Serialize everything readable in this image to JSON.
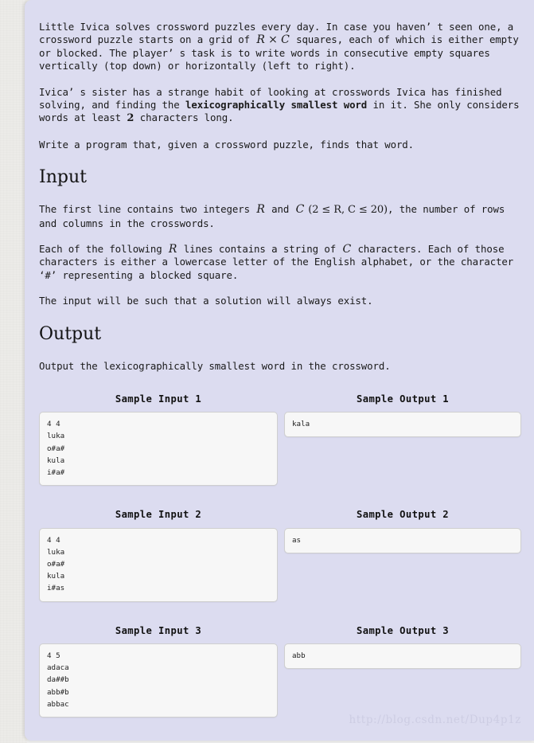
{
  "problem": {
    "paragraphs": [
      {
        "id": "p1",
        "text_parts": [
          "Little Ivica solves crossword puzzles every day. In case you haven’ t seen one, a crossword puzzle starts on a grid of ",
          "R × C",
          " squares, each of which is either empty or blocked. The player’ s task is to write words in consecutive empty squares vertically (top down) or horizontally (left to right)."
        ]
      },
      {
        "id": "p2",
        "text_parts": [
          "Ivica’ s sister has a strange habit of looking at crosswords Ivica has finished solving, and finding the ",
          "lexicographically smallest word",
          " in it. She only considers words at least ",
          "2",
          " characters long."
        ]
      },
      {
        "id": "p3",
        "text": "Write a program that, given a crossword puzzle, finds that word."
      }
    ],
    "input_heading": "Input",
    "input_paragraphs": [
      {
        "id": "in1",
        "text_parts": [
          "The first line contains two integers ",
          "R",
          " and ",
          "C",
          " (2 ≤ R, C ≤ 20)",
          ", the number of rows and columns in the crosswords."
        ]
      },
      {
        "id": "in2",
        "text_parts": [
          "Each of the following ",
          "R",
          " lines contains a string of ",
          "C",
          " characters. Each of those characters is either a lowercase letter of the English alphabet, or the character ‘#’  representing a blocked square."
        ]
      },
      {
        "id": "in3",
        "text": "The input will be such that a solution will always exist."
      }
    ],
    "output_heading": "Output",
    "output_paragraphs": [
      {
        "id": "out1",
        "text": "Output the lexicographically smallest word in the crossword."
      }
    ]
  },
  "samples": [
    {
      "input_title": "Sample Input 1",
      "output_title": "Sample Output 1",
      "input": "4 4\nluka\no#a#\nkula\ni#a#",
      "output": "kala"
    },
    {
      "input_title": "Sample Input 2",
      "output_title": "Sample Output 2",
      "input": "4 4\nluka\no#a#\nkula\ni#as",
      "output": "as"
    },
    {
      "input_title": "Sample Input 3",
      "output_title": "Sample Output 3",
      "input": "4 5\nadaca\nda##b\nabb#b\nabbac",
      "output": "abb"
    }
  ],
  "watermark": "http://blog.csdn.net/Dup4p1z",
  "colors": {
    "page_background": "#dcdcf0",
    "outer_background": "#ecebe8",
    "codebox_background": "#f7f7f7",
    "codebox_border": "#cfcfcf",
    "text": "#1a1a1a",
    "watermark": "#cdcde3"
  }
}
